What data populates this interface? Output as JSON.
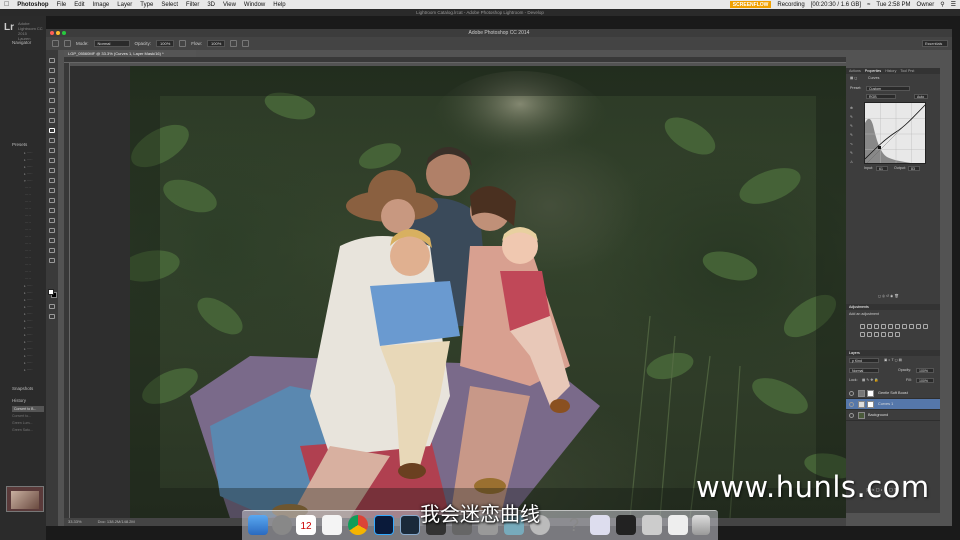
{
  "menubar": {
    "app_name": "Photoshop",
    "items": [
      "File",
      "Edit",
      "Image",
      "Layer",
      "Type",
      "Select",
      "Filter",
      "3D",
      "View",
      "Window",
      "Help"
    ],
    "recording_badge": "SCREENFLOW",
    "recording_label": "Recording",
    "recording_time": "[00:20:30 / 1.6 GB]",
    "clock": "Tue 2:58 PM",
    "user": "Owner"
  },
  "lightroom": {
    "window_title": "Lightroom Catalog.lrcat - Adobe Photoshop Lightroom - Develop",
    "logo": "Lr",
    "identity_line1": "Adobe Lightroom CC 2015",
    "identity_line2": "Lauren",
    "panels": {
      "navigator": "Navigator",
      "presets": "Presets",
      "snapshots": "Snapshots",
      "history": "History"
    },
    "history_items": [
      "Convert to B...",
      "Convert to...",
      "Green Lum...",
      "Green Satu..."
    ]
  },
  "photoshop": {
    "window_title": "Adobe Photoshop CC 2014",
    "doc_tab": "LGP_05560MF @ 33.3% (Curves 1, Layer Mask/16) *",
    "options": {
      "mode_label": "Mode:",
      "mode_value": "Normal",
      "opacity_label": "Opacity:",
      "opacity_value": "100%",
      "flow_label": "Flow:",
      "flow_value": "100%"
    },
    "workspace": "Essentials",
    "status": {
      "zoom": "33.33%",
      "doc": "Doc: 138.2M/148.2M"
    }
  },
  "properties_panel": {
    "tabs": [
      "Actions",
      "Properties",
      "History",
      "Tool Prst"
    ],
    "active_tab": "Properties",
    "header": "Curves",
    "preset_label": "Preset:",
    "preset_value": "Custom",
    "channel_value": "RGB",
    "auto_label": "Auto",
    "input_label": "Input:",
    "input_value": "61",
    "output_label": "Output:",
    "output_value": "83"
  },
  "adjustments_panel": {
    "title": "Adjustments",
    "subtitle": "Add an adjustment"
  },
  "layers_panel": {
    "tabs": [
      "Layers"
    ],
    "filter_value": "p Kind",
    "blend_value": "Normal",
    "opacity_label": "Opacity:",
    "opacity_value": "100%",
    "lock_label": "Lock:",
    "fill_label": "Fill:",
    "fill_value": "100%",
    "layers": [
      {
        "name": "Gentle Soft Boost",
        "selected": false
      },
      {
        "name": "Curves 1",
        "selected": true
      },
      {
        "name": "Background",
        "selected": false
      }
    ]
  },
  "overlay": {
    "subtitle": "我会迷恋曲线",
    "watermark": "www.hunls.com"
  },
  "dock": {
    "calendar_day": "12"
  }
}
